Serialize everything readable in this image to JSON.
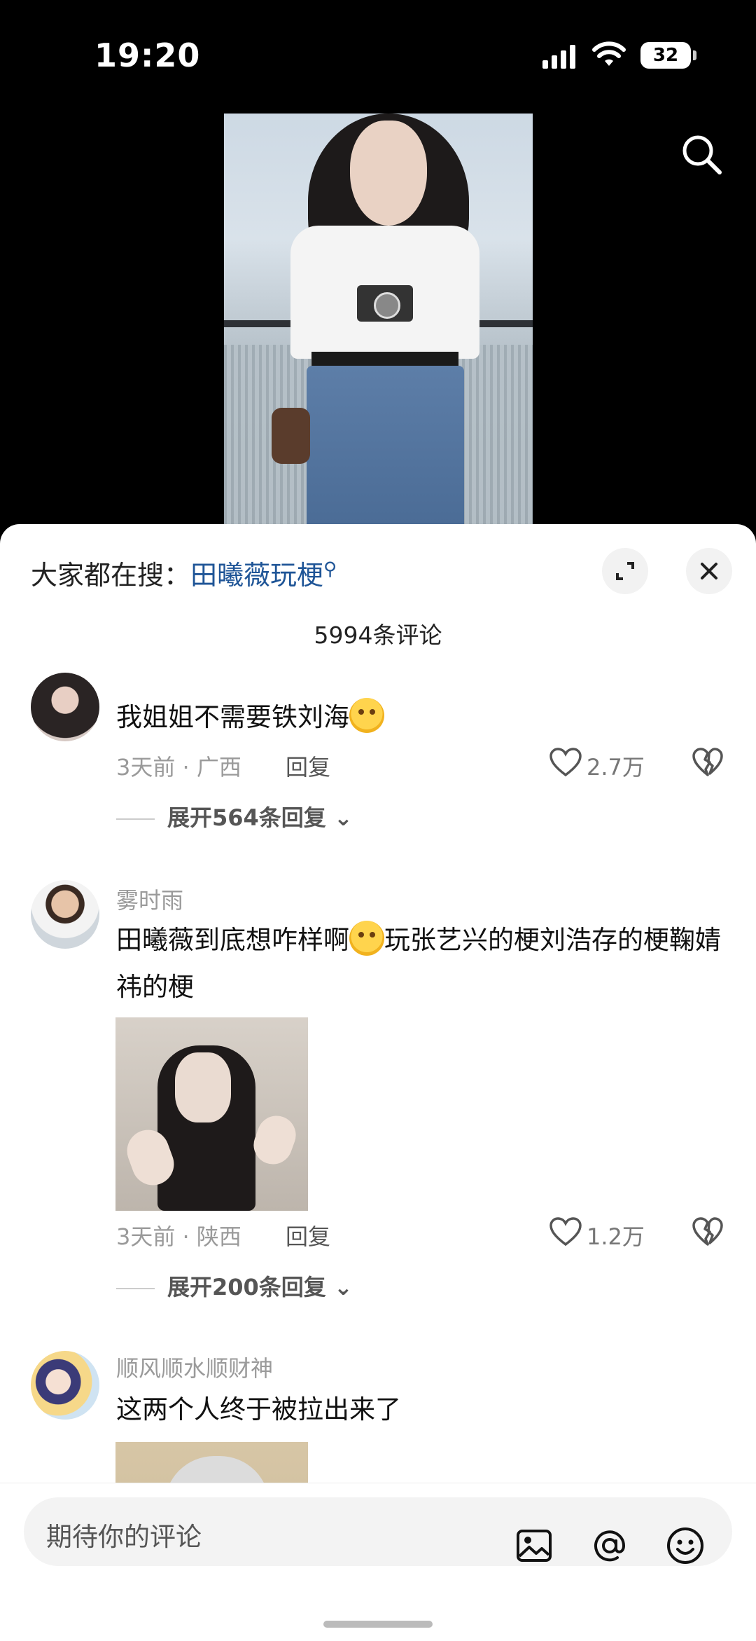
{
  "status_bar": {
    "time": "19:20",
    "battery": "32"
  },
  "sheet": {
    "search_prefix": "大家都在搜：",
    "search_keyword": "田曦薇玩梗",
    "comment_count": "5994条评论"
  },
  "comments": [
    {
      "username": "",
      "text": "我姐姐不需要铁刘海",
      "time_location": "3天前 · 广西",
      "reply_label": "回复",
      "likes": "2.7万",
      "expand": "展开564条回复"
    },
    {
      "username": "雾时雨",
      "text": "田曦薇到底想咋样啊",
      "text2": "玩张艺兴的梗刘浩存的梗鞠婧祎的梗",
      "time_location": "3天前 · 陕西",
      "reply_label": "回复",
      "likes": "1.2万",
      "expand": "展开200条回复"
    },
    {
      "username": "顺风顺水顺财神",
      "text": "这两个人终于被拉出来了"
    }
  ],
  "input": {
    "placeholder": "期待你的评论"
  },
  "icons": [
    "search-icon",
    "expand-icon",
    "close-icon",
    "heart-icon",
    "broken-heart-icon",
    "image-icon",
    "at-icon",
    "emoji-icon"
  ],
  "colors": {
    "keyword": "#1f5597",
    "background_top": "#000000",
    "sheet": "#ffffff"
  }
}
